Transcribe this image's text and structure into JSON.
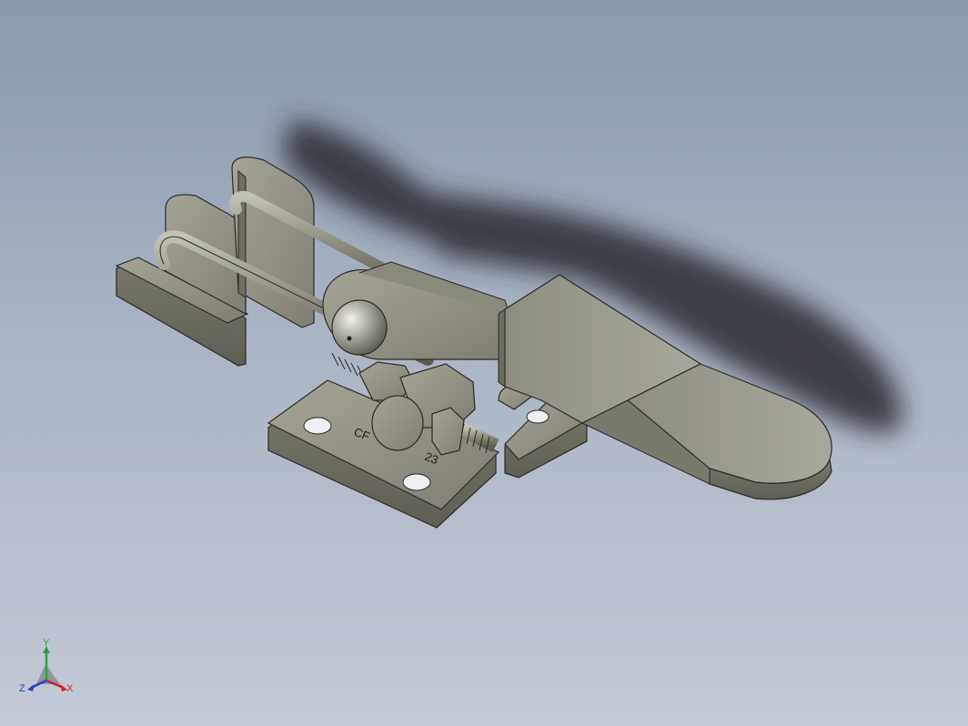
{
  "viewport": {
    "background_top": "#8a99ac",
    "background_bottom": "#c4cad6"
  },
  "model": {
    "part_label": "CF",
    "part_label_suffix": "23",
    "metal_color": "#8b8a7d",
    "shadow_color": "#2a2c33"
  },
  "triad": {
    "x_label": "X",
    "y_label": "Y",
    "z_label": "Z",
    "x_color": "#d0202a",
    "y_color": "#1fa83a",
    "z_color": "#2a3fc8"
  }
}
